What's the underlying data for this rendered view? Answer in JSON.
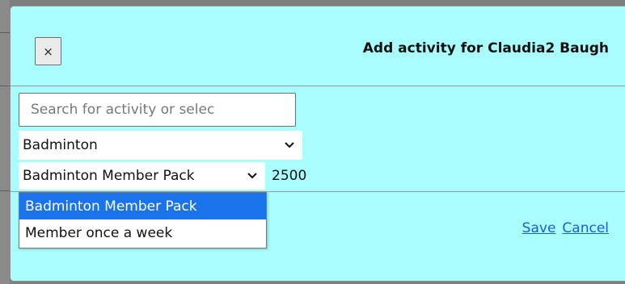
{
  "dialog": {
    "title": "Add activity for Claudia2 Baugh",
    "close_label": "×"
  },
  "search": {
    "placeholder": "Search for activity or selec"
  },
  "activity_select": {
    "selected": "Badminton"
  },
  "pack_select": {
    "selected": "Badminton Member Pack",
    "price": "2500",
    "options": [
      "Badminton Member Pack",
      "Member once a week"
    ]
  },
  "footer": {
    "save_label": "Save",
    "cancel_label": "Cancel"
  },
  "icons": {
    "chevron": "chevron-down-icon",
    "close": "close-icon"
  },
  "colors": {
    "dialog_bg": "#aafdfd",
    "highlight": "#1a73e8",
    "link": "#1a5fd0"
  }
}
